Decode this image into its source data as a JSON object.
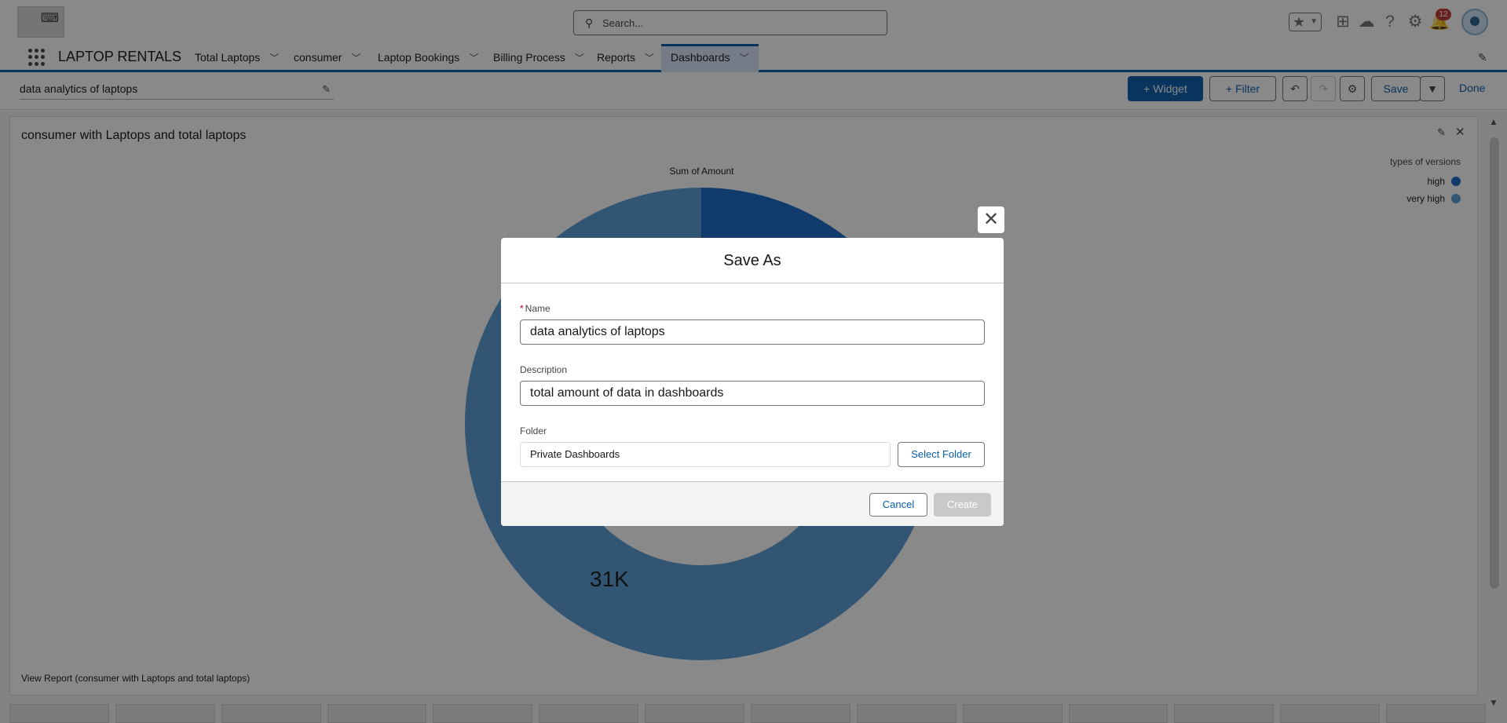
{
  "header": {
    "search_placeholder": "Search...",
    "notification_count": "12"
  },
  "nav": {
    "app_name": "LAPTOP RENTALS",
    "tabs": [
      {
        "label": "Total Laptops"
      },
      {
        "label": "consumer"
      },
      {
        "label": "Laptop Bookings"
      },
      {
        "label": "Billing Process"
      },
      {
        "label": "Reports"
      },
      {
        "label": "Dashboards",
        "active": true
      }
    ]
  },
  "toolbar": {
    "dashboard_name": "data analytics of laptops",
    "widget_label": "Widget",
    "filter_label": "Filter",
    "save_label": "Save",
    "done_label": "Done"
  },
  "widget": {
    "title": "consumer with Laptops and total laptops",
    "view_report": "View Report (consumer with Laptops and total laptops)"
  },
  "chart_data": {
    "type": "pie",
    "title": "Sum of Amount",
    "legend_title": "types of versions",
    "legend_position": "top-right",
    "categories": [
      "high",
      "very high"
    ],
    "values": [
      9,
      31
    ],
    "unit": "K",
    "visible_label": "31K",
    "colors": [
      "#1b6ac9",
      "#5a9bd6"
    ]
  },
  "modal": {
    "title": "Save As",
    "name_label": "Name",
    "name_value": "data analytics of laptops",
    "description_label": "Description",
    "description_value": "total amount of data in dashboards",
    "folder_label": "Folder",
    "folder_value": "Private Dashboards",
    "select_folder_label": "Select Folder",
    "cancel_label": "Cancel",
    "create_label": "Create"
  }
}
